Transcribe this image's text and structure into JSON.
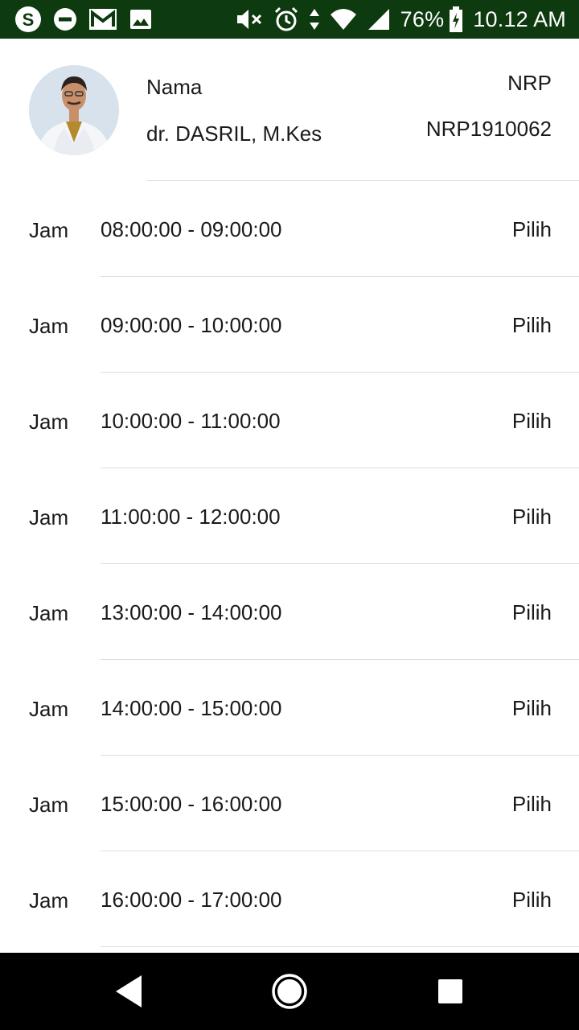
{
  "status_bar": {
    "icons_left": [
      "s-app-icon",
      "minus-circle-icon",
      "gmail-icon",
      "image-icon"
    ],
    "icons_right": [
      "mute-icon",
      "alarm-icon",
      "data-arrows-icon",
      "wifi-icon",
      "signal-icon"
    ],
    "battery_percent": "76%",
    "time": "10.12 AM",
    "background": "#0d3a0f"
  },
  "profile": {
    "label_name": "Nama",
    "name": "dr. DASRIL, M.Kes",
    "label_nrp": "NRP",
    "nrp": "NRP1910062"
  },
  "slots": [
    {
      "label": "Jam",
      "time": "08:00:00 - 09:00:00",
      "action": "Pilih"
    },
    {
      "label": "Jam",
      "time": "09:00:00 - 10:00:00",
      "action": "Pilih"
    },
    {
      "label": "Jam",
      "time": "10:00:00 - 11:00:00",
      "action": "Pilih"
    },
    {
      "label": "Jam",
      "time": "11:00:00 - 12:00:00",
      "action": "Pilih"
    },
    {
      "label": "Jam",
      "time": "13:00:00 - 14:00:00",
      "action": "Pilih"
    },
    {
      "label": "Jam",
      "time": "14:00:00 - 15:00:00",
      "action": "Pilih"
    },
    {
      "label": "Jam",
      "time": "15:00:00 - 16:00:00",
      "action": "Pilih"
    },
    {
      "label": "Jam",
      "time": "16:00:00 - 17:00:00",
      "action": "Pilih"
    }
  ],
  "nav_bar": {
    "buttons": [
      "back-icon",
      "home-icon",
      "recent-apps-icon"
    ]
  }
}
